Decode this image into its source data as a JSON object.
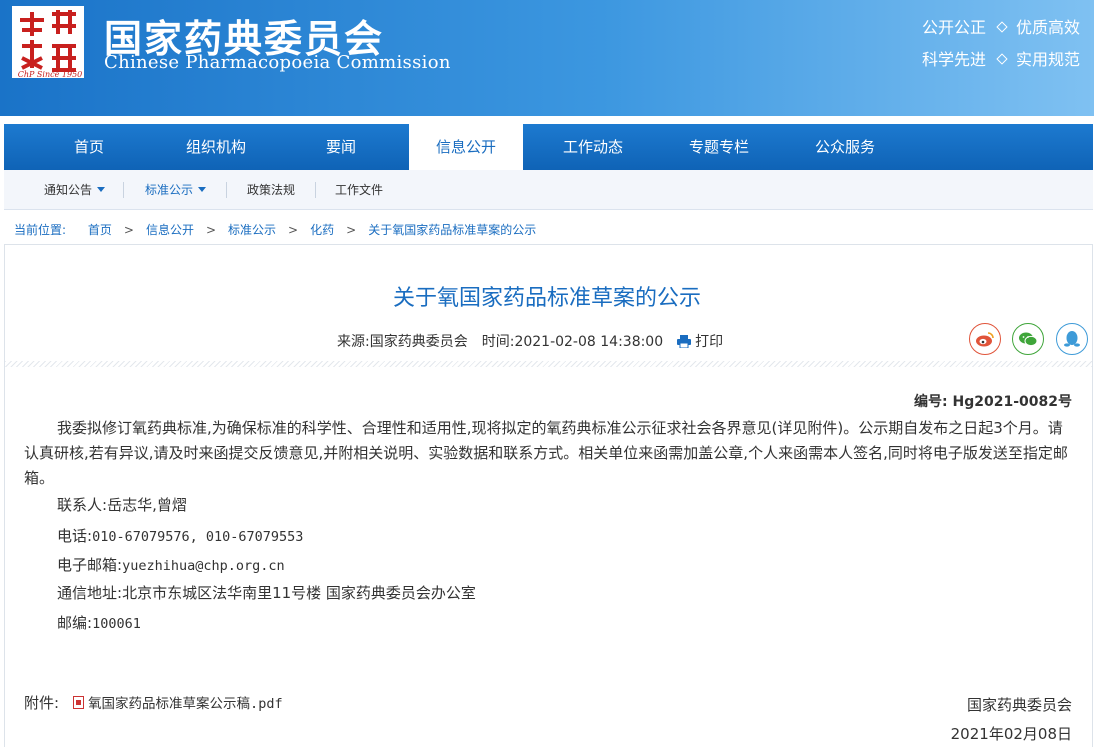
{
  "header": {
    "seal_caption": "ChP Since 1950",
    "title_cn": "国家药典委员会",
    "title_en": "Chinese Pharmacopoeia Commission",
    "slogans": [
      "公开公正",
      "优质高效",
      "科学先进",
      "实用规范"
    ]
  },
  "nav": {
    "items": [
      "首页",
      "组织机构",
      "要闻",
      "信息公开",
      "工作动态",
      "专题专栏",
      "公众服务"
    ],
    "active": "信息公开"
  },
  "subnav": {
    "items": [
      "通知公告",
      "标准公示",
      "政策法规",
      "工作文件"
    ]
  },
  "breadcrumb": {
    "label": "当前位置:",
    "items": [
      "首页",
      "信息公开",
      "标准公示",
      "化药",
      "关于氧国家药品标准草案的公示"
    ]
  },
  "article": {
    "title": "关于氧国家药品标准草案的公示",
    "source_label": "来源:",
    "source": "国家药典委员会",
    "time_label": "时间:",
    "time": "2021-02-08 14:38:00",
    "print_label": "打印",
    "doc_no": "编号: Hg2021-0082号",
    "body": "我委拟修订氧药典标准,为确保标准的科学性、合理性和适用性,现将拟定的氧药典标准公示征求社会各界意见(详见附件)。公示期自发布之日起3个月。请认真研核,若有异议,请及时来函提交反馈意见,并附相关说明、实验数据和联系方式。相关单位来函需加盖公章,个人来函需本人签名,同时将电子版发送至指定邮箱。",
    "contact_label": "联系人:",
    "contact": "岳志华,曾熠",
    "phone_label": "电话:",
    "phone": "010-67079576, 010-67079553",
    "email_label": "电子邮箱:",
    "email": "yuezhihua@chp.org.cn",
    "address_label": "通信地址:",
    "address": "北京市东城区法华南里11号楼 国家药典委员会办公室",
    "zip_label": "邮编:",
    "zip": "100061",
    "attachment_label": "附件:",
    "attachment": "氧国家药品标准草案公示稿.pdf",
    "sign_org": "国家药典委员会",
    "sign_date": "2021年02月08日"
  },
  "colors": {
    "brand_blue": "#1a6dc0",
    "weibo": "#e0543a",
    "wechat": "#3fa53a",
    "qq": "#3e9bd8"
  }
}
